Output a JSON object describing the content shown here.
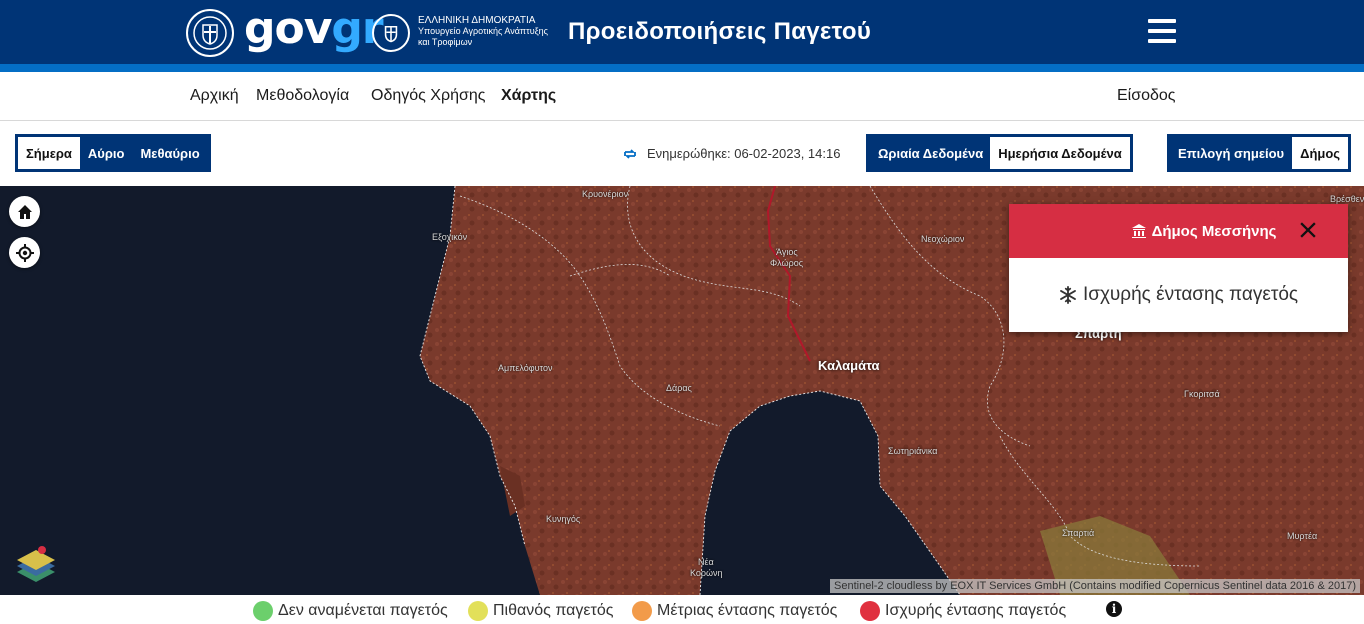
{
  "header": {
    "brand_gov": "gov",
    "brand_gr": "gr",
    "ministry_line1": "ΕΛΛΗΝΙΚΗ ΔΗΜΟΚΡΑΤΙΑ",
    "ministry_line2": "Υπουργείο Αγροτικής Ανάπτυξης",
    "ministry_line3": "και Τροφίμων",
    "title": "Προειδοποιήσεις Παγετού",
    "menu_icon": "hamburger-menu-icon"
  },
  "nav": {
    "items": [
      "Αρχική",
      "Μεθοδολογία",
      "Οδηγός Χρήσης",
      "Χάρτης"
    ],
    "active": "Χάρτης",
    "login": "Είσοδος"
  },
  "toolbar": {
    "days": [
      "Σήμερα",
      "Αύριο",
      "Μεθαύριο"
    ],
    "day_selected": "Σήμερα",
    "updated": "Ενημερώθηκε: 06-02-2023, 14:16",
    "data_modes": [
      "Ωριαία Δεδομένα",
      "Ημερήσια Δεδομένα"
    ],
    "data_mode_selected": "Ημερήσια Δεδομένα",
    "point_label": "Επιλογή σημείου",
    "point_mode": "Δήμος"
  },
  "map": {
    "labels": {
      "kryoneri": "Κρυονέριον",
      "exochikon": "Εξοχικόν",
      "agios_floros_1": "Άγιος",
      "agios_floros_2": "Φλώρος",
      "neochorion": "Νεοχώριον",
      "ampelofyton": "Αμπελόφυτον",
      "kalamata": "Καλαμάτα",
      "daras": "Δάρας",
      "sotirianika": "Σωτηριάνικα",
      "gkoritsa": "Γκοριτσά",
      "kynigos": "Κυνηγός",
      "nea_koroni_1": "Νέα",
      "nea_koroni_2": "Κορώνη",
      "spartia": "Σπαρτιά",
      "myrtea": "Μυρτέα",
      "sparti": "Σπάρτη",
      "vresthena": "Βρέσθενα"
    },
    "attribution": "Sentinel-2 cloudless by EOX IT Services GmbH (Contains modified Copernicus Sentinel data 2016 & 2017)"
  },
  "popup": {
    "municipality": "Δήμος Μεσσήνης",
    "warning": "Ισχυρής έντασης παγετός",
    "header_color": "#d62e43"
  },
  "legend": {
    "items": [
      {
        "label": "Δεν αναμένεται παγετός",
        "color": "#6ccf6c"
      },
      {
        "label": "Πιθανός παγετός",
        "color": "#e2e05a"
      },
      {
        "label": "Μέτριας έντασης παγετός",
        "color": "#f29b4a"
      },
      {
        "label": "Ισχυρής έντασης παγετός",
        "color": "#e0303f"
      }
    ],
    "info": "i"
  }
}
